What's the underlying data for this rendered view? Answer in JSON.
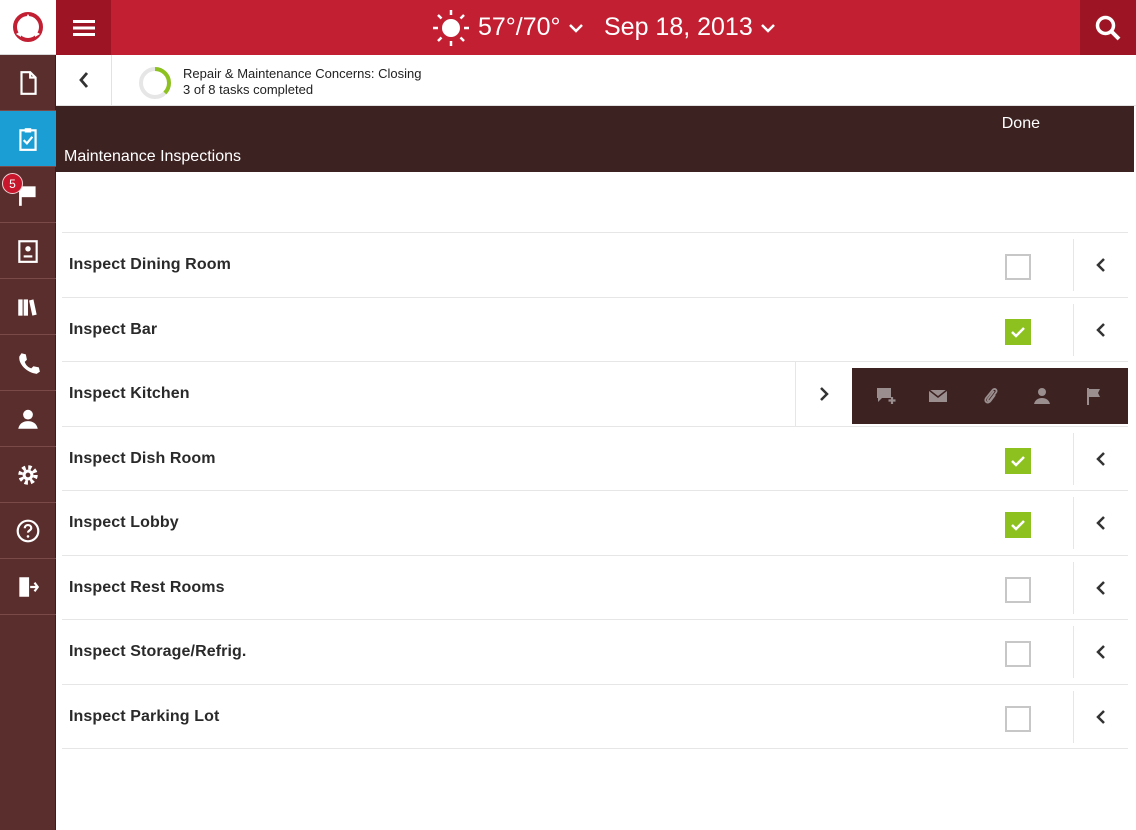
{
  "header": {
    "weather_icon": "sun-icon",
    "temperature": "57°/70°",
    "date": "Sep 18, 2013"
  },
  "sidebar": {
    "items": [
      {
        "icon": "document-icon"
      },
      {
        "icon": "clipboard-check-icon",
        "active": true
      },
      {
        "icon": "flag-icon",
        "badge": "5"
      },
      {
        "icon": "contact-card-icon"
      },
      {
        "icon": "library-books-icon"
      },
      {
        "icon": "phone-icon"
      },
      {
        "icon": "person-icon"
      },
      {
        "icon": "gear-icon"
      },
      {
        "icon": "help-icon"
      },
      {
        "icon": "logout-icon"
      }
    ]
  },
  "task": {
    "title": "Repair & Maintenance Concerns: Closing",
    "count": "3 of 8 tasks completed",
    "progress_fraction": 0.375
  },
  "section": {
    "done_label": "Done",
    "title": "Maintenance Inspections"
  },
  "rows": [
    {
      "label": "Inspect Dining Room",
      "checked": false
    },
    {
      "label": "Inspect Bar",
      "checked": true
    },
    {
      "label": "Inspect Kitchen",
      "expanded": true
    },
    {
      "label": "Inspect Dish Room",
      "checked": true
    },
    {
      "label": "Inspect Lobby",
      "checked": true
    },
    {
      "label": "Inspect Rest Rooms",
      "checked": false
    },
    {
      "label": "Inspect Storage/Refrig.",
      "checked": false
    },
    {
      "label": "Inspect Parking Lot",
      "checked": false
    }
  ],
  "actions": [
    "add-comment-icon",
    "mail-icon",
    "paperclip-icon",
    "assign-person-icon",
    "flag-icon"
  ],
  "colors": {
    "topbar": "#c21f33",
    "sidebar": "#5a2e2c",
    "active": "#1b9ed4",
    "section_header": "#3d2222",
    "check_green": "#8cc11f"
  }
}
